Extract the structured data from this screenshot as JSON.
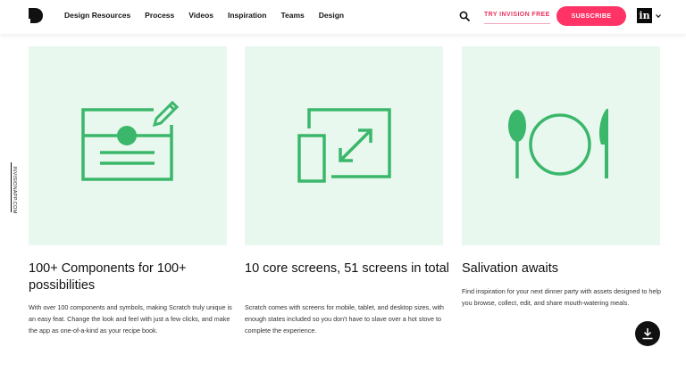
{
  "header": {
    "logo_icon": "invision-d-logo",
    "nav": [
      "Design Resources",
      "Process",
      "Videos",
      "Inspiration",
      "Teams",
      "Design"
    ],
    "try_label": "TRY INVISION FREE",
    "subscribe_label": "SUBSCRIBE",
    "brand_badge": "in"
  },
  "side_label": "INVISIONAPP.COM",
  "cards": [
    {
      "icon": "component-card-icon",
      "title": "100+ Components for 100+ possibilities",
      "description": "With over 100 components and symbols, making Scratch truly unique is an easy feat. Change the look and feel with just a few clicks, and make the app as one-of-a-kind as your recipe book."
    },
    {
      "icon": "resize-screens-icon",
      "title": "10 core screens, 51 screens in total",
      "description": "Scratch comes with screens for mobile, tablet, and desktop sizes, with enough states included so you don't have to slave over a hot stove to complete the experience."
    },
    {
      "icon": "spoon-plate-knife-icon",
      "title": "Salivation awaits",
      "description": "Find inspiration for your next dinner party with assets designed to help you browse, collect, edit, and share mouth-watering meals."
    }
  ],
  "colors": {
    "accent": "#ff3366",
    "green": "#3ab76a",
    "card_bg": "#e9f8ef"
  }
}
